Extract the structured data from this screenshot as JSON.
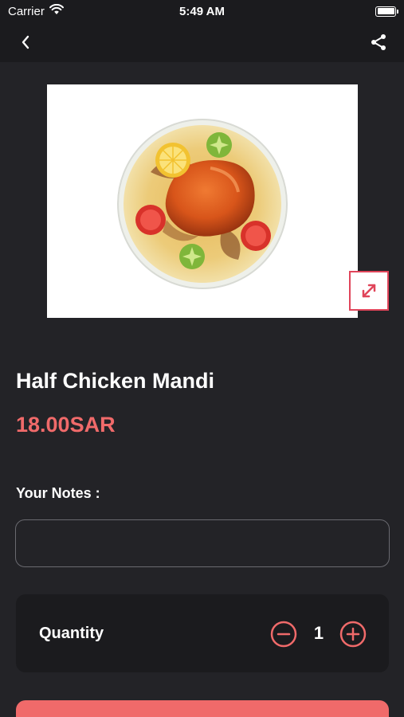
{
  "status_bar": {
    "carrier": "Carrier",
    "time": "5:49 AM"
  },
  "nav": {
    "back_icon": "chevron-left-icon",
    "share_icon": "share-icon"
  },
  "product": {
    "image_alt": "dish-image",
    "name": "Half Chicken Mandi",
    "price": "18.00SAR"
  },
  "notes": {
    "label": "Your Notes :",
    "value": "",
    "placeholder": ""
  },
  "quantity": {
    "label": "Quantity",
    "value": "1"
  },
  "colors": {
    "accent": "#f06a6a",
    "expand_border": "#e0455a",
    "background": "#232327",
    "bar": "#1b1b1e"
  }
}
